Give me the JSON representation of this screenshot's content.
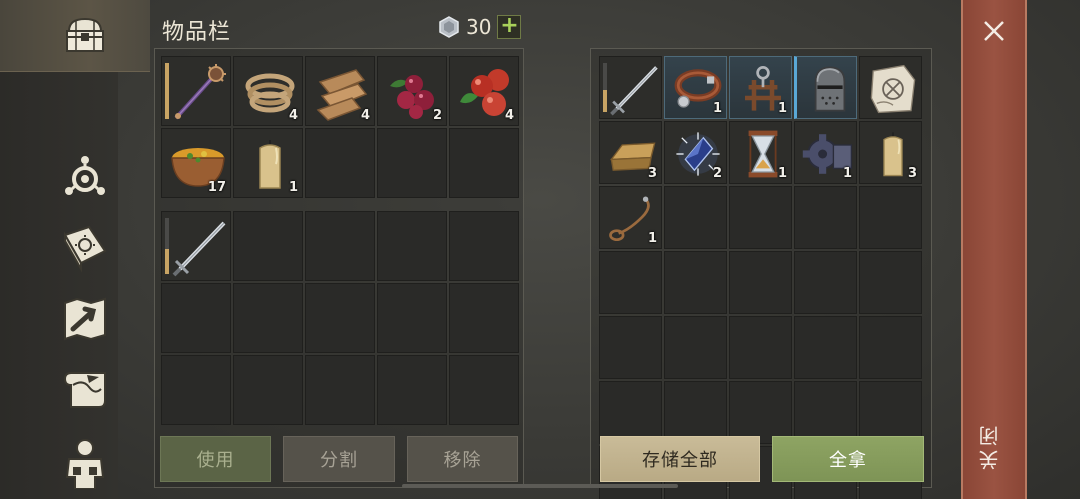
{
  "header": {
    "title": "物品栏",
    "gem_count": "30",
    "add_label": "+"
  },
  "sidebar": {
    "items": [
      {
        "icon": "chest-icon",
        "active": true
      },
      {
        "icon": "skills-icon",
        "active": false
      },
      {
        "icon": "recipe-book-icon",
        "active": false
      },
      {
        "icon": "map-icon",
        "active": false
      },
      {
        "icon": "scroll-icon",
        "active": false
      },
      {
        "icon": "character-icon",
        "active": false
      }
    ]
  },
  "inventory": {
    "top_slots": [
      {
        "item": "mace-icon",
        "qty": ""
      },
      {
        "item": "rope-icon",
        "qty": "4"
      },
      {
        "item": "cloth-icon",
        "qty": "4"
      },
      {
        "item": "berries-icon",
        "qty": "2"
      },
      {
        "item": "apples-icon",
        "qty": "4"
      },
      {
        "item": "stew-bowl-icon",
        "qty": "17"
      },
      {
        "item": "candle-icon",
        "qty": "1"
      },
      {
        "item": "",
        "qty": ""
      },
      {
        "item": "",
        "qty": ""
      },
      {
        "item": "",
        "qty": ""
      }
    ],
    "equip_slots": [
      {
        "item": "sword-icon",
        "qty": ""
      }
    ]
  },
  "container": {
    "slots": [
      {
        "item": "sword-icon",
        "qty": ""
      },
      {
        "item": "dog-collar-icon",
        "qty": "1"
      },
      {
        "item": "harness-icon",
        "qty": "1"
      },
      {
        "item": "knight-helmet-icon",
        "qty": ""
      },
      {
        "item": "treasure-map-icon",
        "qty": ""
      },
      {
        "item": "gold-ingot-icon",
        "qty": "3"
      },
      {
        "item": "crystal-icon",
        "qty": "2"
      },
      {
        "item": "hourglass-icon",
        "qty": "1"
      },
      {
        "item": "gear-icon",
        "qty": "1"
      },
      {
        "item": "candle-icon",
        "qty": "3"
      },
      {
        "item": "leash-icon",
        "qty": "1"
      }
    ]
  },
  "buttons": {
    "use": "使用",
    "split": "分割",
    "remove": "移除",
    "store_all": "存储全部",
    "take_all": "全拿"
  },
  "close": {
    "label": "关闭"
  },
  "colors": {
    "close_strip": "#9a5342",
    "take_all": "#8ea463",
    "store_all": "#c9bb98",
    "highlight_blue": "#5aa8d6",
    "durability": "#c8a464"
  }
}
